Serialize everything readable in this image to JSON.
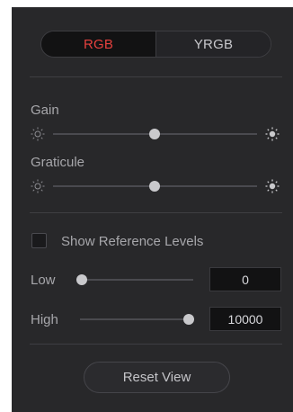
{
  "mode_toggle": {
    "options": [
      "RGB",
      "YRGB"
    ],
    "selected": "RGB"
  },
  "gain": {
    "label": "Gain",
    "value_fraction": 0.5
  },
  "graticule": {
    "label": "Graticule",
    "value_fraction": 0.5
  },
  "reference_levels": {
    "checkbox_label": "Show Reference Levels",
    "checked": false
  },
  "low": {
    "label": "Low",
    "value": "0",
    "value_fraction": 0.0
  },
  "high": {
    "label": "High",
    "value": "10000",
    "value_fraction": 1.0
  },
  "reset_button": {
    "label": "Reset View"
  },
  "colors": {
    "accent_selected": "#e6413e",
    "panel_bg": "#28282a"
  },
  "icons": {
    "slider_min": "sun-dim-icon",
    "slider_max": "sun-bright-icon"
  }
}
